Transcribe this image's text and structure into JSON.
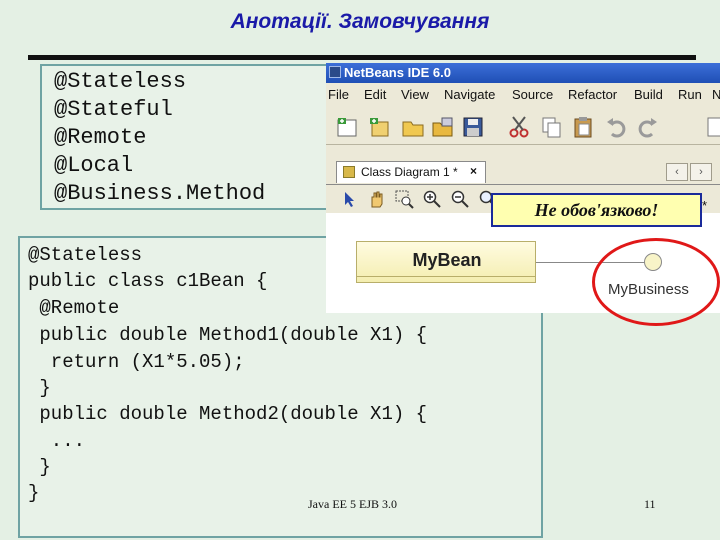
{
  "slide": {
    "title": "Анотації. Замовчування",
    "footer_center": "Java EE 5 EJB 3.0",
    "page_number": "11"
  },
  "annotations_list": [
    "@Stateless",
    "@Stateful",
    "@Remote",
    "@Local",
    "@Business.Method"
  ],
  "code_lines": [
    "@Stateless",
    "public class c1Bean {",
    " @Remote",
    " public double Method1(double X1) {",
    "  return (X1*5.05);",
    " }",
    " public double Method2(double X1) {",
    "  ...",
    " }",
    "}"
  ],
  "ide": {
    "window_title": "NetBeans IDE 6.0",
    "menu": [
      "File",
      "Edit",
      "View",
      "Navigate",
      "Source",
      "Refactor",
      "Build",
      "Run",
      "N"
    ],
    "tab_label": "Class Diagram 1 *",
    "tab_close": "×",
    "nav_prev": "‹",
    "nav_next": "›",
    "tail_mark": "*",
    "class_name": "MyBean",
    "interface_name": "MyBusiness"
  },
  "callout": {
    "text": "Не обов'язково!"
  },
  "colors": {
    "title": "#1a1aa8",
    "highlight_border": "#e01818",
    "note_bg": "#ffffb0"
  }
}
